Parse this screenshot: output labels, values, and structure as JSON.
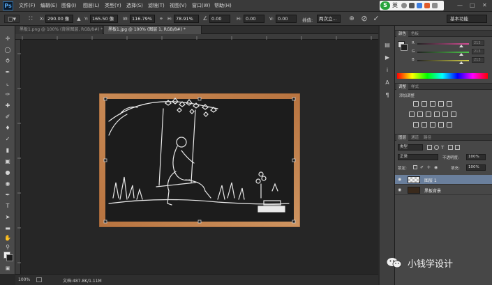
{
  "menubar": {
    "logo": "Ps",
    "items": [
      "文件(F)",
      "编辑(E)",
      "图像(I)",
      "图层(L)",
      "类型(Y)",
      "选择(S)",
      "滤镜(T)",
      "视图(V)",
      "窗口(W)",
      "帮助(H)"
    ],
    "ime": {
      "logo": "S",
      "lang": "英"
    }
  },
  "options": {
    "x_label": "X:",
    "x_value": "290.00 像",
    "y_label": "Y:",
    "y_value": "165.50 像",
    "w_label": "W:",
    "w_value": "116.79%",
    "h_label": "H:",
    "h_value": "78.91%",
    "angle_value": "0.00",
    "hskew_label": "H:",
    "hskew_value": "0.00",
    "vskew_label": "V:",
    "vskew_value": "0.00",
    "interp_label": "插值:",
    "interp_value": "两次立...",
    "workspace": "基本功能"
  },
  "tabs": [
    {
      "label": "黑板1.png @ 100% (背景图层, RGB/8#) *",
      "active": false
    },
    {
      "label": "黑板1.jpg @ 100% (图层 1, RGB/8#) *",
      "active": true
    }
  ],
  "status": {
    "zoom": "100%",
    "doc": "文档:487.8K/1.11M"
  },
  "color_panel": {
    "tabs": [
      "颜色",
      "色板"
    ],
    "channels": [
      {
        "name": "R",
        "value": "213",
        "color": "#d84e97"
      },
      {
        "name": "G",
        "value": "213",
        "color": "#4ec94b"
      },
      {
        "name": "B",
        "value": "213",
        "color": "#4d78d9"
      }
    ]
  },
  "adjust_panel": {
    "tabs": [
      "调整",
      "样式"
    ],
    "title": "添加调整"
  },
  "layers_panel": {
    "tabs": [
      "图层",
      "通道",
      "路径"
    ],
    "kind_label": "类型",
    "blend_mode": "正常",
    "opacity_label": "不透明度:",
    "opacity_value": "100%",
    "lock_label": "锁定:",
    "fill_label": "填充:",
    "fill_value": "100%",
    "layers": [
      {
        "name": "图层 1",
        "selected": true
      },
      {
        "name": "黑板背景",
        "selected": false
      }
    ]
  },
  "watermark": {
    "text": "小钱学设计"
  }
}
